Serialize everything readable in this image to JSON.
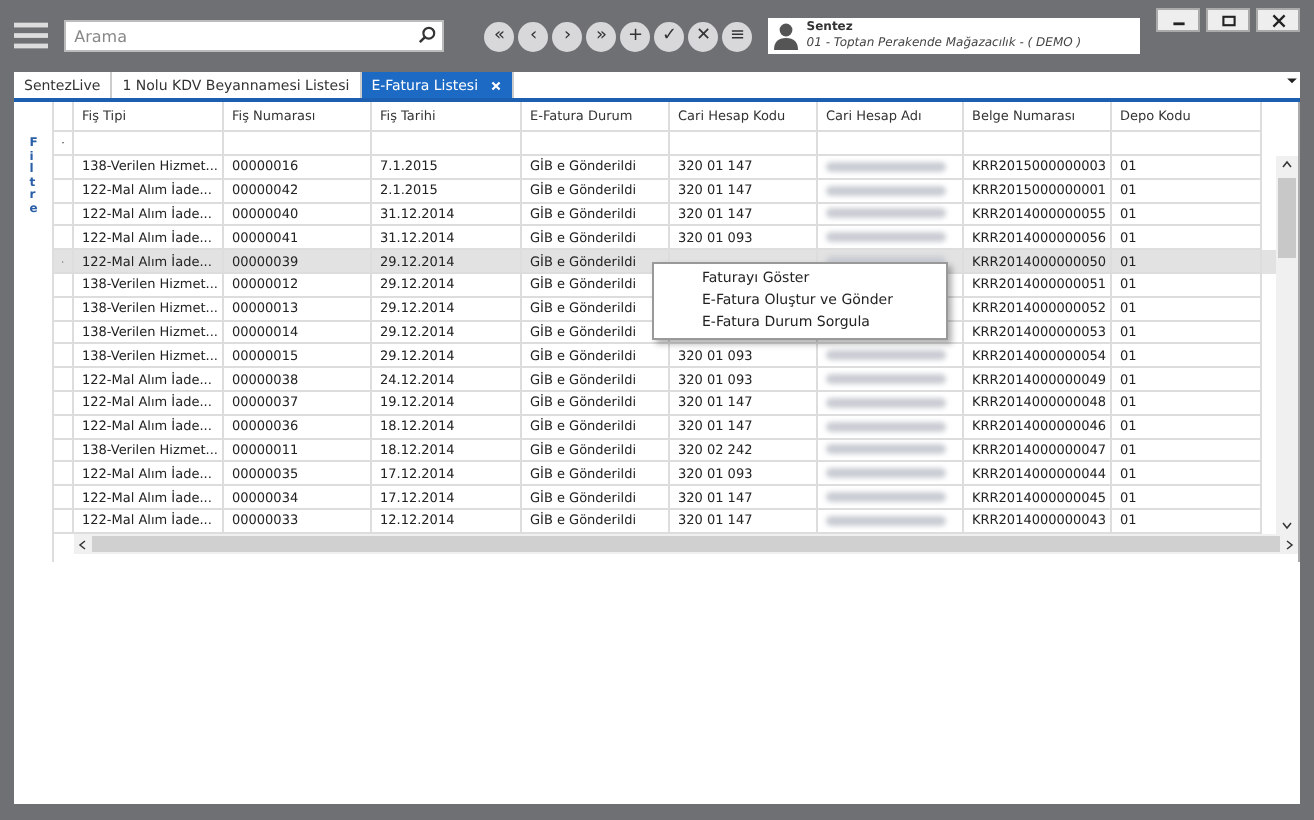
{
  "toolbar": {
    "search": {
      "placeholder": "Arama"
    },
    "nav_buttons": [
      "«",
      "‹",
      "›",
      "»",
      "+",
      "✓",
      "✕",
      "≡"
    ],
    "user": {
      "name": "Sentez",
      "company": "01 - Toptan Perakende Mağazacılık - ( DEMO )"
    }
  },
  "tabs": [
    {
      "label": "SentezLive",
      "selected": false
    },
    {
      "label": "1 Nolu KDV Beyannamesi Listesi",
      "selected": false
    },
    {
      "label": "E-Fatura Listesi",
      "selected": true
    }
  ],
  "filter_panel": {
    "label": "Filtre"
  },
  "table": {
    "columns": [
      "Fiş Tipi",
      "Fiş Numarası",
      "Fiş Tarihi",
      "E-Fatura Durum",
      "Cari Hesap Kodu",
      "Cari Hesap Adı",
      "Belge Numarası",
      "Depo Kodu"
    ],
    "rows": [
      {
        "selected": false,
        "cells": [
          "138-Verilen Hizmet...",
          "00000016",
          "7.1.2015",
          "GİB e Gönderildi",
          "320 01 147",
          null,
          "KRR2015000000003",
          "01"
        ]
      },
      {
        "selected": false,
        "cells": [
          "122-Mal Alım İade...",
          "00000042",
          "2.1.2015",
          "GİB e Gönderildi",
          "320 01 147",
          null,
          "KRR2015000000001",
          "01"
        ]
      },
      {
        "selected": false,
        "cells": [
          "122-Mal Alım İade...",
          "00000040",
          "31.12.2014",
          "GİB e Gönderildi",
          "320 01 147",
          null,
          "KRR2014000000055",
          "01"
        ]
      },
      {
        "selected": false,
        "cells": [
          "122-Mal Alım İade...",
          "00000041",
          "31.12.2014",
          "GİB e Gönderildi",
          "320 01 093",
          null,
          "KRR2014000000056",
          "01"
        ]
      },
      {
        "selected": true,
        "cells": [
          "122-Mal Alım İade...",
          "00000039",
          "29.12.2014",
          "GİB e Gönderildi",
          null,
          null,
          "KRR2014000000050",
          "01"
        ]
      },
      {
        "selected": false,
        "cells": [
          "138-Verilen Hizmet...",
          "00000012",
          "29.12.2014",
          "GİB e Gönderildi",
          null,
          null,
          "KRR2014000000051",
          "01"
        ]
      },
      {
        "selected": false,
        "cells": [
          "138-Verilen Hizmet...",
          "00000013",
          "29.12.2014",
          "GİB e Gönderildi",
          null,
          null,
          "KRR2014000000052",
          "01"
        ]
      },
      {
        "selected": false,
        "cells": [
          "138-Verilen Hizmet...",
          "00000014",
          "29.12.2014",
          "GİB e Gönderildi",
          null,
          null,
          "KRR2014000000053",
          "01"
        ]
      },
      {
        "selected": false,
        "cells": [
          "138-Verilen Hizmet...",
          "00000015",
          "29.12.2014",
          "GİB e Gönderildi",
          "320 01 093",
          null,
          "KRR2014000000054",
          "01"
        ]
      },
      {
        "selected": false,
        "cells": [
          "122-Mal Alım İade...",
          "00000038",
          "24.12.2014",
          "GİB e Gönderildi",
          "320 01 093",
          null,
          "KRR2014000000049",
          "01"
        ]
      },
      {
        "selected": false,
        "cells": [
          "122-Mal Alım İade...",
          "00000037",
          "19.12.2014",
          "GİB e Gönderildi",
          "320 01 147",
          null,
          "KRR2014000000048",
          "01"
        ]
      },
      {
        "selected": false,
        "cells": [
          "122-Mal Alım İade...",
          "00000036",
          "18.12.2014",
          "GİB e Gönderildi",
          "320 01 147",
          null,
          "KRR2014000000046",
          "01"
        ]
      },
      {
        "selected": false,
        "cells": [
          "138-Verilen Hizmet...",
          "00000011",
          "18.12.2014",
          "GİB e Gönderildi",
          "320 02 242",
          null,
          "KRR2014000000047",
          "01"
        ]
      },
      {
        "selected": false,
        "cells": [
          "122-Mal Alım İade...",
          "00000035",
          "17.12.2014",
          "GİB e Gönderildi",
          "320 01 093",
          null,
          "KRR2014000000044",
          "01"
        ]
      },
      {
        "selected": false,
        "cells": [
          "122-Mal Alım İade...",
          "00000034",
          "17.12.2014",
          "GİB e Gönderildi",
          "320 01 147",
          null,
          "KRR2014000000045",
          "01"
        ]
      },
      {
        "selected": false,
        "cells": [
          "122-Mal Alım İade...",
          "00000033",
          "12.12.2014",
          "GİB e Gönderildi",
          "320 01 147",
          null,
          "KRR2014000000043",
          "01"
        ]
      }
    ]
  },
  "context_menu": [
    "Faturayı Göster",
    "E-Fatura Oluştur ve Gönder",
    "E-Fatura Durum Sorgula"
  ]
}
